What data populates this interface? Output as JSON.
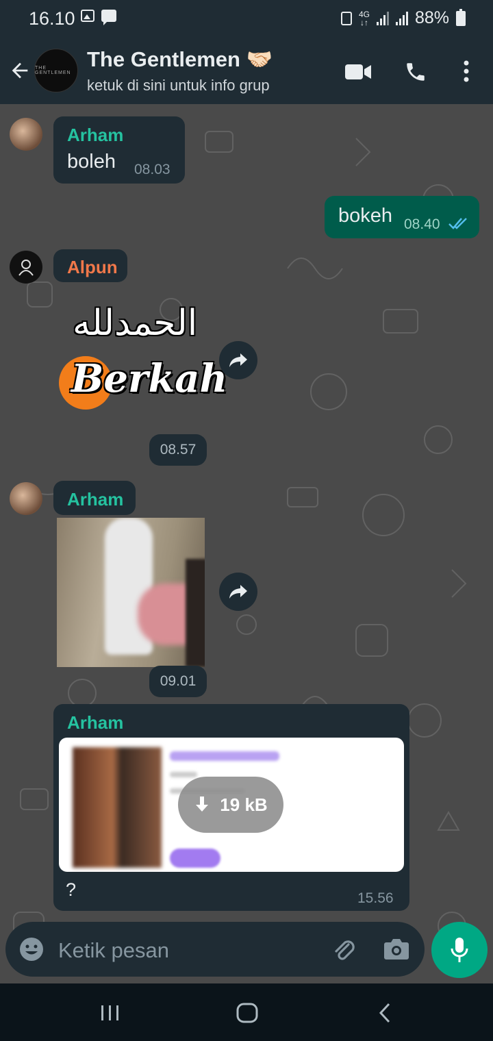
{
  "status_bar": {
    "time": "16.10",
    "network": "4G",
    "battery": "88%"
  },
  "header": {
    "title": "The Gentlemen 🤝🏻",
    "subtitle": "ketuk di sini untuk info grup",
    "avatar_text": "THE GENTLEMEN"
  },
  "messages": [
    {
      "sender": "Arham",
      "text": "boleh",
      "time": "08.03",
      "sender_color": "#25c2a0"
    },
    {
      "text": "bokeh",
      "time": "08.40"
    },
    {
      "sender": "Alpun",
      "sender_color": "#f0784a",
      "sticker_arabic": "الحمدلله",
      "sticker_word": "Berkah",
      "time": "08.57"
    },
    {
      "sender": "Arham",
      "sender_color": "#25c2a0",
      "time": "09.01"
    },
    {
      "sender": "Arham",
      "sender_color": "#25c2a0",
      "download_size": "19 kB",
      "text": "?",
      "time": "15.56"
    }
  ],
  "input": {
    "placeholder": "Ketik pesan"
  },
  "colors": {
    "header_bg": "#1f2c34",
    "incoming_bg": "#1f2c34",
    "outgoing_bg": "#005c4b",
    "accent": "#00a884",
    "read_ticks": "#53bdeb"
  }
}
